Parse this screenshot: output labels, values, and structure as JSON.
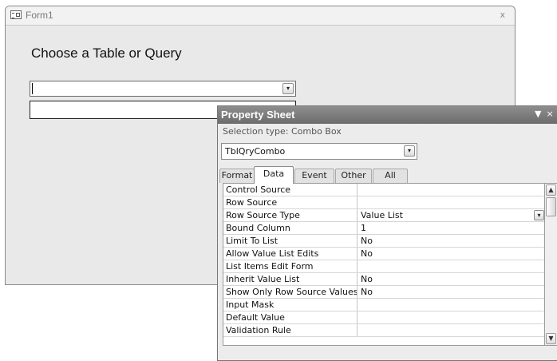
{
  "form": {
    "title": "Form1",
    "close_glyph": "x",
    "label": "Choose a Table or Query",
    "combo_value": "",
    "combo_dropdown_glyph": "▾"
  },
  "property_sheet": {
    "title": "Property Sheet",
    "menu_glyph": "▼",
    "close_glyph": "×",
    "selection_type": "Selection type:  Combo Box",
    "object_combo_value": "TblQryCombo",
    "tabs": [
      {
        "label": "Format",
        "active": false
      },
      {
        "label": "Data",
        "active": true
      },
      {
        "label": "Event",
        "active": false
      },
      {
        "label": "Other",
        "active": false
      },
      {
        "label": "All",
        "active": false
      }
    ],
    "rows": [
      {
        "name": "Control Source",
        "value": ""
      },
      {
        "name": "Row Source",
        "value": ""
      },
      {
        "name": "Row Source Type",
        "value": "Value List"
      },
      {
        "name": "Bound Column",
        "value": "1"
      },
      {
        "name": "Limit To List",
        "value": "No"
      },
      {
        "name": "Allow Value List Edits",
        "value": "No"
      },
      {
        "name": "List Items Edit Form",
        "value": ""
      },
      {
        "name": "Inherit Value List",
        "value": "No"
      },
      {
        "name": "Show Only Row Source Values",
        "value": "No"
      },
      {
        "name": "Input Mask",
        "value": ""
      },
      {
        "name": "Default Value",
        "value": ""
      },
      {
        "name": "Validation Rule",
        "value": ""
      }
    ],
    "scroll_up_glyph": "▲",
    "scroll_down_glyph": "▼"
  },
  "icons": {
    "form_icon": "form-view-icon",
    "dropdown": "chevron-down-icon"
  }
}
